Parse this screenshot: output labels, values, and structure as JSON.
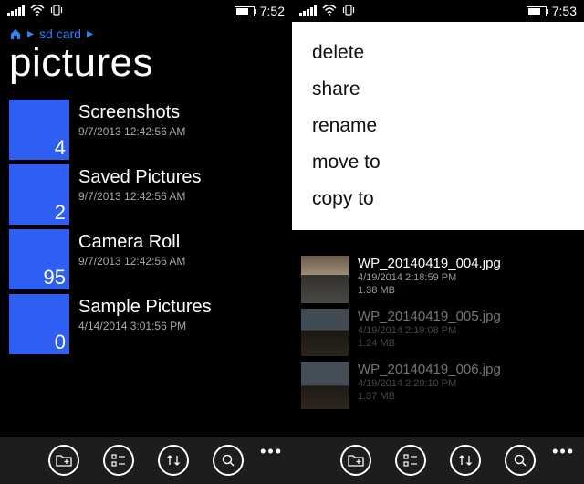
{
  "left": {
    "status": {
      "time": "7:52"
    },
    "breadcrumb": {
      "root_icon": "home-icon",
      "crumb": "sd card"
    },
    "title": "pictures",
    "folders": [
      {
        "name": "Screenshots",
        "date": "9/7/2013 12:42:56 AM",
        "count": "4"
      },
      {
        "name": "Saved Pictures",
        "date": "9/7/2013 12:42:56 AM",
        "count": "2"
      },
      {
        "name": "Camera Roll",
        "date": "9/7/2013 12:42:56 AM",
        "count": "95"
      },
      {
        "name": "Sample Pictures",
        "date": "4/14/2014 3:01:56 PM",
        "count": "0"
      }
    ]
  },
  "right": {
    "status": {
      "time": "7:53"
    },
    "context_menu": [
      "delete",
      "share",
      "rename",
      "move to",
      "copy to"
    ],
    "files": [
      {
        "name": "WP_20140419_004.jpg",
        "date": "4/19/2014 2:18:59 PM",
        "size": "1.38 MB",
        "dimmed": false
      },
      {
        "name": "WP_20140419_005.jpg",
        "date": "4/19/2014 2:19:08 PM",
        "size": "1.24 MB",
        "dimmed": true
      },
      {
        "name": "WP_20140419_006.jpg",
        "date": "4/19/2014 2:20:10 PM",
        "size": "1.37 MB",
        "dimmed": true
      }
    ]
  },
  "appbar_icons": [
    "new-folder-icon",
    "select-icon",
    "sort-icon",
    "search-icon"
  ]
}
